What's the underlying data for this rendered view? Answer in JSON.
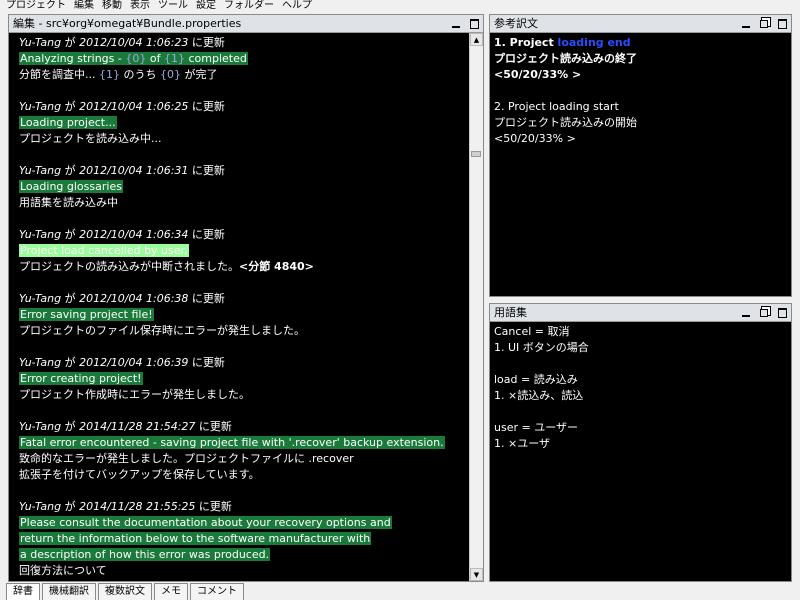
{
  "menu": [
    "プロジェクト",
    "編集",
    "移動",
    "表示",
    "ツール",
    "設定",
    "フォルダー",
    "ヘルプ"
  ],
  "editor": {
    "title": "編集 - src¥org¥omegat¥Bundle.properties",
    "entries": [
      {
        "meta_user": "Yu-Tang",
        "meta_ga": "が",
        "meta_date": "2012/10/04 1:06:23",
        "meta_suffix": "に更新",
        "src_pre": "Analyzing strings - ",
        "src_ph1": "{0}",
        "src_mid": " of ",
        "src_ph2": "{1}",
        "src_post": " completed",
        "tgt_pre": "分節を調査中... ",
        "tgt_ph1": "{1}",
        "tgt_mid": " のうち ",
        "tgt_ph2": "{0}",
        "tgt_post": " が完了"
      },
      {
        "meta_user": "Yu-Tang",
        "meta_ga": "が",
        "meta_date": "2012/10/04 1:06:25",
        "meta_suffix": "に更新",
        "src": "Loading project...",
        "tgt": "プロジェクトを読み込み中..."
      },
      {
        "meta_user": "Yu-Tang",
        "meta_ga": "が",
        "meta_date": "2012/10/04 1:06:31",
        "meta_suffix": "に更新",
        "src": "Loading glossaries",
        "tgt": "用語集を読み込み中"
      },
      {
        "meta_user": "Yu-Tang",
        "meta_ga": "が",
        "meta_date": "2012/10/04 1:06:34",
        "meta_suffix": "に更新",
        "src": "Project load cancelled by user.",
        "tgt": "プロジェクトの読み込みが中断されました。",
        "tgt_bold": "<分節 4840>"
      },
      {
        "meta_user": "Yu-Tang",
        "meta_ga": "が",
        "meta_date": "2012/10/04 1:06:38",
        "meta_suffix": "に更新",
        "src": "Error saving project file!",
        "tgt": "プロジェクトのファイル保存時にエラーが発生しました。"
      },
      {
        "meta_user": "Yu-Tang",
        "meta_ga": "が",
        "meta_date": "2012/10/04 1:06:39",
        "meta_suffix": "に更新",
        "src": "Error creating project!",
        "tgt": "プロジェクト作成時にエラーが発生しました。"
      },
      {
        "meta_user": "Yu-Tang",
        "meta_ga": "が",
        "meta_date": "2014/11/28 21:54:27",
        "meta_suffix": "に更新",
        "src": "Fatal error encountered - saving project file with '.recover' backup extension.",
        "tgt1": "致命的なエラーが発生しました。プロジェクトファイルに .recover",
        "tgt2": "拡張子を付けてバックアップを保存しています。"
      },
      {
        "meta_user": "Yu-Tang",
        "meta_ga": "が",
        "meta_date": "2014/11/28 21:55:25",
        "meta_suffix": "に更新",
        "src1": "Please consult the documentation about your recovery options and",
        "src2": "return the information below to the software manufacturer with",
        "src3": "a description of how this error was produced.",
        "tgt1": "回復方法について"
      }
    ]
  },
  "reference": {
    "title": "参考訳文",
    "item1_prefix": "1. Project ",
    "item1_blue": "loading end",
    "item1_target": "プロジェクト読み込みの終了",
    "item1_score": "<50/20/33% >",
    "item2_source": "2. Project loading start",
    "item2_target": "プロジェクト読み込みの開始",
    "item2_score": "<50/20/33% >"
  },
  "glossary": {
    "title": "用語集",
    "lines": [
      "Cancel = 取消",
      "1. UI ボタンの場合",
      "",
      "load = 読み込み",
      "1. ×読込み、読込",
      "",
      "user = ユーザー",
      "1. ×ユーザ"
    ]
  },
  "tabs": [
    "辞書",
    "機械翻訳",
    "複数訳文",
    "メモ",
    "コメント"
  ],
  "colors": {
    "segment_bg": "#1a7a3a",
    "active_segment_bg": "#9aff9a",
    "pane_bg": "#000000",
    "match_highlight": "#2a4dff"
  }
}
